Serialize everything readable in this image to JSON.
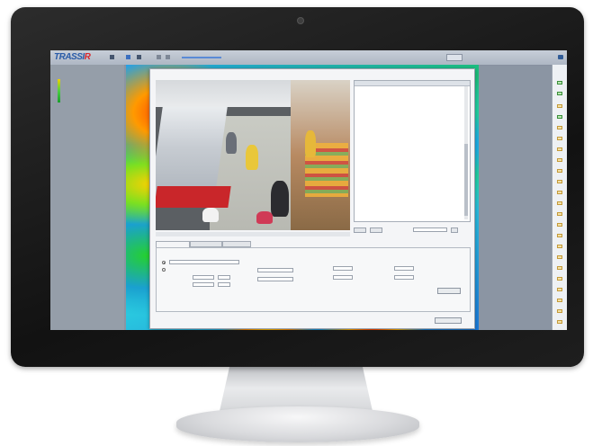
{
  "app": {
    "logo_main": "TRASSI",
    "logo_accent": "R",
    "top_center_title": "",
    "left_panel_label": ""
  },
  "dialog": {
    "title": "",
    "list_label": "",
    "list_headers": [
      "",
      ""
    ],
    "list_rows": [
      {
        "text": "",
        "color": "blue"
      }
    ],
    "tabs": [
      "",
      "",
      ""
    ],
    "ok_label": "",
    "cancel_label": ""
  },
  "colors": {
    "logo_blue": "#2a5ca8",
    "logo_red": "#d7282f",
    "heat_red": "#ff3a00",
    "heat_yellow": "#ffd000",
    "heat_green": "#25d030",
    "heat_blue": "#25a0e8",
    "list_link_blue": "#2d5fa6",
    "list_link_red": "#c02424"
  },
  "icons": [
    "camera-icon",
    "user-icon",
    "toolbar-icon",
    "scale-ramp-icon"
  ]
}
